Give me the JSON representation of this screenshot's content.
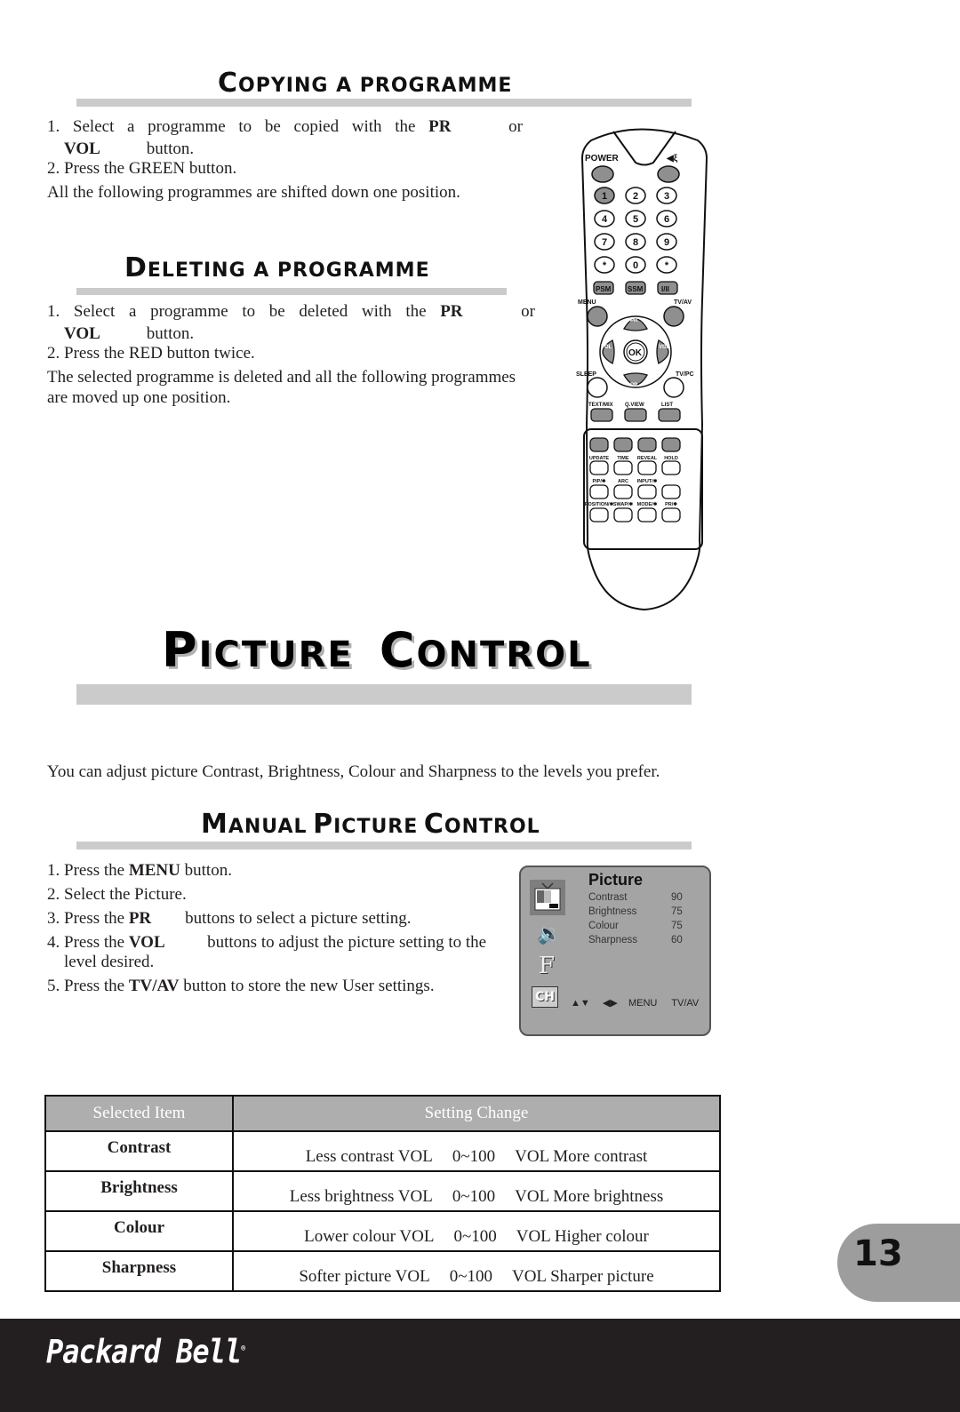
{
  "copying": {
    "title_first": "C",
    "title_rest": "OPYING  A  PROGRAMME",
    "step1": {
      "num": "1.",
      "words": [
        "Select",
        "a",
        "programme",
        "to",
        "be",
        "copied",
        "with",
        "the"
      ],
      "bold": "PR",
      "tail": "or",
      "line2_bold": "VOL",
      "line2_rest": "button."
    },
    "step2": "2. Press the GREEN button.",
    "note": "All the following programmes are shifted down one position."
  },
  "deleting": {
    "title_first": "D",
    "title_rest": "ELETING  A  PROGRAMME",
    "step1": {
      "num": "1.",
      "words": [
        "Select",
        "a",
        "programme",
        "to",
        "be",
        "deleted",
        "with",
        "the"
      ],
      "bold": "PR",
      "tail": "or",
      "line2_bold": "VOL",
      "line2_rest": "button."
    },
    "step2": "2. Press the RED button twice.",
    "note_line1": "The selected programme is deleted and all the following programmes",
    "note_line2": "are moved up one position."
  },
  "remote": {
    "labels": {
      "power": "POWER",
      "mute": "mute-icon",
      "keys": [
        "1",
        "2",
        "3",
        "4",
        "5",
        "6",
        "7",
        "8",
        "9",
        "*",
        "0",
        "*"
      ],
      "psm": "PSM",
      "ssm": "SSM",
      "dual": "I/II",
      "menu": "MENU",
      "tvav": "TV/AV",
      "sleep": "SLEEP",
      "tvpc": "TV/PC",
      "pr": "PR",
      "vol": "VOL",
      "ok": "OK",
      "textmix": "TEXT/MIX",
      "qview": "Q.VIEW",
      "list": "LIST",
      "update": "UPDATE",
      "time": "TIME",
      "reveal": "REVEAL",
      "hold": "HOLD",
      "pip": "PIP/✱",
      "arc": "ARC",
      "input": "INPUT/✱",
      "position": "POSITION/✱",
      "swap": "SWAP/✱",
      "mode": "MODE/✱",
      "pr_star": "PR/✱"
    }
  },
  "picture_control": {
    "title_w1_first": "P",
    "title_w1_rest": "ICTURE",
    "title_w2_first": "C",
    "title_w2_rest": "ONTROL",
    "intro": "You can adjust picture Contrast, Brightness, Colour and Sharpness to the levels you prefer."
  },
  "manual": {
    "title_w1_first": "M",
    "title_w1_rest": "ANUAL",
    "title_w2_first": "P",
    "title_w2_rest": "ICTURE",
    "title_w3_first": "C",
    "title_w3_rest": "ONTROL",
    "steps": [
      {
        "pre": "1. Press the ",
        "bold": "MENU",
        "post": " button."
      },
      {
        "pre": "2. Select the Picture.",
        "bold": "",
        "post": ""
      },
      {
        "pre": "3. Press the ",
        "bold": "PR",
        "post": "        buttons to select a picture setting."
      },
      {
        "pre": "4. Press the ",
        "bold": "VOL",
        "post": "          buttons to adjust the picture setting to the"
      },
      {
        "pre": "    level desired.",
        "bold": "",
        "post": ""
      },
      {
        "pre": "5. Press the ",
        "bold": "TV/AV",
        "post": " button to store the new User settings."
      }
    ]
  },
  "osd": {
    "title": "Picture",
    "items": [
      {
        "label": "Contrast",
        "value": "90"
      },
      {
        "label": "Brightness",
        "value": "75"
      },
      {
        "label": "Colour",
        "value": "75"
      },
      {
        "label": "Sharpness",
        "value": "60"
      }
    ],
    "nav": {
      "updown": "▲▼",
      "leftright": "◀▶",
      "menu": "MENU",
      "tvav": "TV/AV"
    },
    "icons": [
      "picture-icon",
      "sound-icon",
      "feature-icon",
      "channel-icon"
    ],
    "f_letter": "F",
    "ch_letters": "CH"
  },
  "table": {
    "headers": [
      "Selected Item",
      "Setting Change"
    ],
    "rows": [
      {
        "item": "Contrast",
        "left": "Less contrast VOL",
        "range": "0~100",
        "right": "VOL More contrast"
      },
      {
        "item": "Brightness",
        "left": "Less brightness VOL",
        "range": "0~100",
        "right": "VOL More brightness"
      },
      {
        "item": "Colour",
        "left": "Lower colour VOL",
        "range": "0~100",
        "right": "VOL Higher colour"
      },
      {
        "item": "Sharpness",
        "left": "Softer picture VOL",
        "range": "0~100",
        "right": "VOL Sharper picture"
      }
    ]
  },
  "page_number": "13",
  "footer": {
    "brand": "Packard Bell",
    "reg": "®"
  }
}
